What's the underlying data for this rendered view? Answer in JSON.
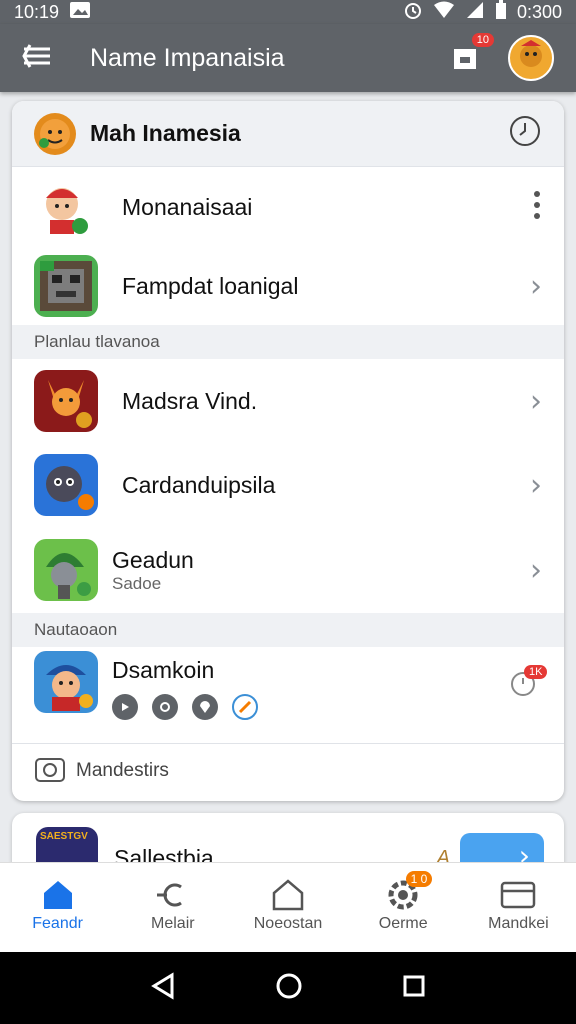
{
  "status": {
    "time": "10:19",
    "clock": "0:300"
  },
  "appbar": {
    "title": "Name Impanaisia",
    "badge": "10"
  },
  "card": {
    "header": "Mah Inamesia",
    "rows_top": [
      {
        "label": "Monanaisaai"
      },
      {
        "label": "Fampdat loanigal"
      }
    ],
    "section1": "Planlau tlavanoa",
    "rows_mid": [
      {
        "label": "Madsra Vind."
      },
      {
        "label": "Cardanduipsila"
      },
      {
        "label": "Geadun",
        "sub": "Sadoe"
      }
    ],
    "section2": "Nautaoaon",
    "special": {
      "label": "Dsamkoin",
      "badge": "1K"
    },
    "footer": "Mandestirs"
  },
  "bottom_card": {
    "icon_text": "SAESTGV",
    "label": "Sallestbia",
    "deco": "A"
  },
  "nav": [
    {
      "label": "Feandr"
    },
    {
      "label": "Melair"
    },
    {
      "label": "Noeostan"
    },
    {
      "label": "Oerme",
      "badge": "1 0"
    },
    {
      "label": "Mandkei"
    }
  ],
  "colors": {
    "appbar": "#5f6368",
    "accent": "#1a73e8",
    "badge": "#e53935"
  }
}
